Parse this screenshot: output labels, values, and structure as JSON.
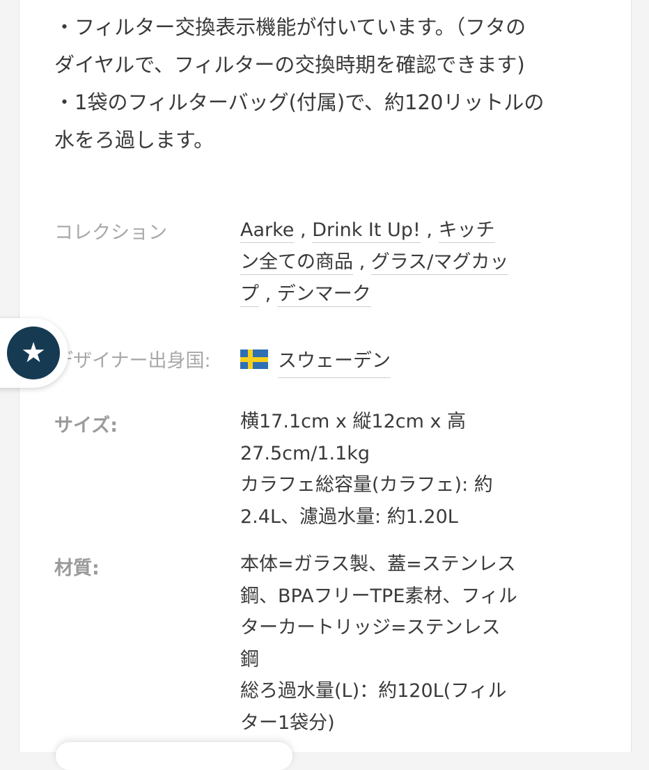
{
  "description": {
    "line1": "・フィルター交換表示機能が付いています。（フタの",
    "line2": "ダイヤルで、フィルターの交換時期を確認できます)",
    "line3": "・1袋のフィルターバッグ(付属)で、約120リットルの",
    "line4": "水をろ過します。"
  },
  "collection": {
    "label": "コレクション",
    "links": [
      "Aarke",
      "Drink It Up!",
      "キッチ",
      "ン全ての商品",
      "グラス/マグカッ",
      "プ",
      "デンマーク"
    ],
    "separator": ","
  },
  "designer": {
    "label": "デザイナー出身国:",
    "country": "スウェーデン",
    "flag_icon": "sweden-flag-icon"
  },
  "size": {
    "label": "サイズ:",
    "lines": [
      "横17.1cm x 縦12cm x 高",
      "27.5cm/1.1kg",
      "カラフェ総容量(カラフェ): 約",
      "2.4L、濾過水量: 約1.20L"
    ]
  },
  "material": {
    "label": "材質:",
    "lines": [
      "本体=ガラス製、蓋=ステンレス",
      "鋼、BPAフリーTPE素材、フィル",
      "ターカートリッジ=ステンレス",
      "鋼",
      "総ろ過水量(L)：約120L(フィル",
      "ター1袋分)"
    ]
  },
  "favorite_button": {
    "icon": "star-icon",
    "glyph": "★",
    "color": "#163a52"
  }
}
